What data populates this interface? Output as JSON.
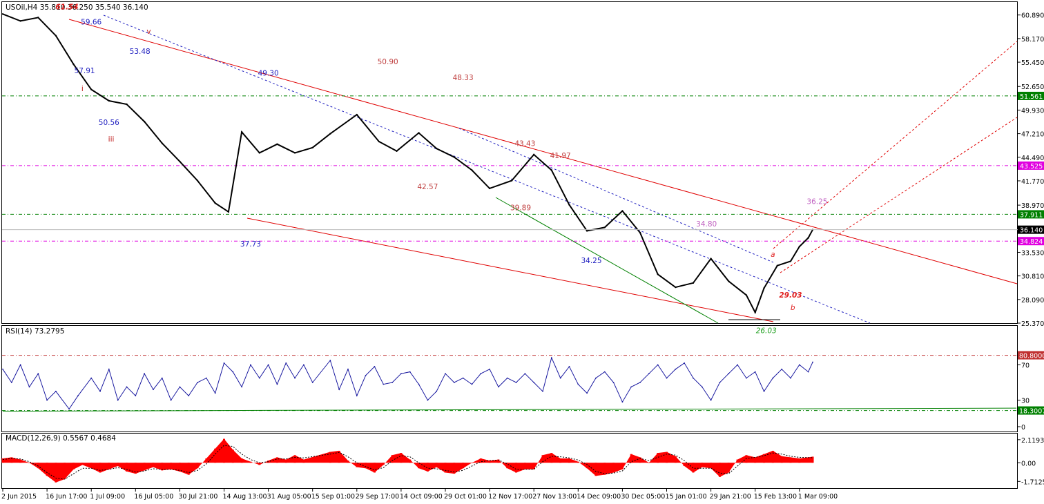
{
  "chart_data": [
    {
      "type": "line",
      "panel": "price",
      "header": "USOil,H4  35.810 36.250 35.540 36.140",
      "symbol": "USOil,H4",
      "ohlc": {
        "open": 35.81,
        "high": 36.25,
        "low": 35.54,
        "close": 36.14
      },
      "current_price_label": "36.140",
      "y_ticks": [
        "60.890",
        "58.170",
        "55.450",
        "52.650",
        "49.930",
        "47.210",
        "44.490",
        "41.770",
        "38.970",
        "36.140",
        "33.530",
        "30.810",
        "28.090",
        "25.370"
      ],
      "ylim": [
        25.37,
        62.3
      ],
      "levels": [
        {
          "label": "51.561",
          "value": 51.561,
          "color": "#008000"
        },
        {
          "label": "43.525",
          "value": 43.525,
          "color": "#e000e0"
        },
        {
          "label": "37.911",
          "value": 37.911,
          "color": "#008000"
        },
        {
          "label": "34.824",
          "value": 34.824,
          "color": "#e000e0"
        }
      ],
      "x_labels": [
        "2 Jun 2015",
        "16 Jun 17:00",
        "1 Jul 09:00",
        "16 Jul 05:00",
        "30 Jul 21:00",
        "14 Aug 13:00",
        "31 Aug 05:00",
        "15 Sep 01:00",
        "29 Sep 17:00",
        "14 Oct 09:00",
        "29 Oct 01:00",
        "12 Nov 17:00",
        "27 Nov 13:00",
        "14 Dec 09:00",
        "30 Dec 05:00",
        "15 Jan 01:00",
        "29 Jan 21:00",
        "15 Feb 13:00",
        "1 Mar 09:00"
      ],
      "x_index": [
        0,
        1,
        2,
        3,
        4,
        5,
        6,
        7,
        8,
        9,
        10,
        11,
        12,
        13,
        14,
        15,
        16,
        17,
        18
      ],
      "series": [
        {
          "values": [
            61.0,
            60.2,
            60.6,
            58.5,
            55.2,
            52.3,
            51.0,
            50.6,
            48.6,
            46.1,
            44.0,
            41.8,
            39.2,
            38.2,
            47.4,
            45.0,
            46.0,
            45.0,
            45.6,
            47.2,
            49.4,
            46.3,
            45.2,
            47.3,
            45.5,
            44.5,
            43.0,
            40.9,
            41.8,
            44.8,
            43.0,
            39.0,
            36.0,
            36.4,
            38.3,
            35.8,
            31.0,
            29.5,
            30.0,
            32.8,
            30.2,
            28.6,
            26.6,
            29.4,
            32.0,
            32.5,
            34.2,
            35.2,
            36.14
          ],
          "x_index": [
            0,
            0.4,
            0.8,
            1.2,
            1.6,
            2.0,
            2.4,
            2.8,
            3.2,
            3.6,
            4.0,
            4.4,
            4.8,
            5.1,
            5.4,
            5.8,
            6.2,
            6.6,
            7.0,
            7.4,
            8.0,
            8.5,
            8.9,
            9.4,
            9.8,
            10.2,
            10.6,
            11.0,
            11.5,
            12.0,
            12.4,
            12.8,
            13.2,
            13.6,
            14.0,
            14.4,
            14.8,
            15.2,
            15.6,
            16.0,
            16.4,
            16.8,
            17.0,
            17.2,
            17.5,
            17.8,
            18.0,
            18.2,
            18.3
          ]
        }
      ],
      "annotations": [
        {
          "text": "61.54",
          "value": 61.54,
          "x_index": 1.45,
          "color": "#e02020"
        },
        {
          "text": "59.66",
          "value": 59.8,
          "x_index": 2.0,
          "color": "#2020c0"
        },
        {
          "text": "v",
          "value": 58.7,
          "x_index": 3.3,
          "color": "#c02020"
        },
        {
          "text": "53.48",
          "value": 56.4,
          "x_index": 3.1,
          "color": "#2020c0"
        },
        {
          "text": "57.91",
          "value": 54.2,
          "x_index": 1.85,
          "color": "#2020c0"
        },
        {
          "text": "i",
          "value": 52.1,
          "x_index": 1.8,
          "color": "#c02020"
        },
        {
          "text": "49.30",
          "value": 53.9,
          "x_index": 6.0,
          "color": "#2020c0"
        },
        {
          "text": "50.90",
          "value": 55.2,
          "x_index": 8.7,
          "color": "#c04040"
        },
        {
          "text": "48.33",
          "value": 53.4,
          "x_index": 10.4,
          "color": "#c04040"
        },
        {
          "text": "50.56",
          "value": 48.2,
          "x_index": 2.4,
          "color": "#2020c0"
        },
        {
          "text": "iii",
          "value": 46.3,
          "x_index": 2.45,
          "color": "#c02020"
        },
        {
          "text": "43.43",
          "value": 45.8,
          "x_index": 11.8,
          "color": "#c04040"
        },
        {
          "text": "41.97",
          "value": 44.4,
          "x_index": 12.6,
          "color": "#c04040"
        },
        {
          "text": "42.57",
          "value": 40.8,
          "x_index": 9.6,
          "color": "#c04040"
        },
        {
          "text": "39.89",
          "value": 38.4,
          "x_index": 11.7,
          "color": "#c04040"
        },
        {
          "text": "37.73",
          "value": 34.2,
          "x_index": 5.6,
          "color": "#2020c0"
        },
        {
          "text": "34.25",
          "value": 32.3,
          "x_index": 13.3,
          "color": "#2020c0"
        },
        {
          "text": "34.80",
          "value": 36.5,
          "x_index": 15.9,
          "color": "#c060c0"
        },
        {
          "text": "36.25",
          "value": 39.1,
          "x_index": 18.4,
          "color": "#c060c0"
        },
        {
          "text": "a",
          "value": 33.0,
          "x_index": 17.4,
          "color": "#e02020"
        },
        {
          "text": "29.03",
          "value": 28.3,
          "x_index": 17.8,
          "color": "#e02020"
        },
        {
          "text": "b",
          "value": 26.9,
          "x_index": 17.85,
          "color": "#e02020"
        },
        {
          "text": "26.03",
          "value": 24.2,
          "x_index": 17.25,
          "color": "#20a020"
        }
      ]
    },
    {
      "type": "line",
      "panel": "rsi",
      "header": "RSI(14) 73.2795",
      "ylim": [
        0,
        100
      ],
      "y_ticks": [
        "70",
        "30",
        "0"
      ],
      "levels": [
        {
          "label": "80.8000",
          "value": 80.8,
          "color": "#c03030"
        },
        {
          "label": "18.3007",
          "value": 18.3,
          "color": "#008000"
        }
      ],
      "series": [
        {
          "values": [
            65,
            50,
            70,
            45,
            60,
            30,
            40,
            20,
            35,
            55,
            40,
            65,
            30,
            45,
            35,
            60,
            42,
            55,
            30,
            45,
            35,
            50,
            55,
            38,
            72,
            62,
            45,
            70,
            55,
            70,
            48,
            72,
            55,
            70,
            50,
            75,
            42,
            65,
            35,
            58,
            68,
            48,
            50,
            60,
            62,
            48,
            30,
            40,
            60,
            50,
            55,
            48,
            60,
            65,
            45,
            55,
            50,
            60,
            50,
            40,
            78,
            55,
            68,
            48,
            38,
            55,
            62,
            50,
            28,
            45,
            50,
            60,
            70,
            55,
            65,
            72,
            55,
            45,
            30,
            50,
            60,
            70,
            55,
            62,
            40,
            55,
            65,
            55,
            70,
            62,
            73
          ],
          "x_index": [
            0,
            0.2,
            0.4,
            0.6,
            0.8,
            1.0,
            1.2,
            1.5,
            1.7,
            2.0,
            2.2,
            2.4,
            2.6,
            2.8,
            3.0,
            3.2,
            3.4,
            3.6,
            3.8,
            4.0,
            4.2,
            4.4,
            4.6,
            4.8,
            5.0,
            5.2,
            5.4,
            5.6,
            5.8,
            6.0,
            6.2,
            6.4,
            6.6,
            6.8,
            7.0,
            7.4,
            7.6,
            7.8,
            8.0,
            8.2,
            8.4,
            8.6,
            8.8,
            9.0,
            9.2,
            9.4,
            9.6,
            9.8,
            10.0,
            10.2,
            10.4,
            10.6,
            10.8,
            11.0,
            11.2,
            11.4,
            11.6,
            11.8,
            12.0,
            12.2,
            12.4,
            12.6,
            12.8,
            13.0,
            13.2,
            13.4,
            13.6,
            13.8,
            14.0,
            14.2,
            14.4,
            14.6,
            14.8,
            15.0,
            15.2,
            15.4,
            15.6,
            15.8,
            16.0,
            16.2,
            16.4,
            16.6,
            16.8,
            17.0,
            17.2,
            17.4,
            17.6,
            17.8,
            18.0,
            18.2,
            18.3
          ]
        }
      ]
    },
    {
      "type": "bar",
      "panel": "macd",
      "header": "MACD(12,26,9) 0.5567 0.4684",
      "ylim": [
        -2.2,
        2.3
      ],
      "y_ticks": [
        {
          "label": "2.1193",
          "value": 2.1193
        },
        {
          "label": "0.00",
          "value": 0
        },
        {
          "label": "-1.7125",
          "value": -1.7125
        }
      ],
      "values": [
        0.4,
        0.5,
        0.3,
        0.0,
        -0.5,
        -1.2,
        -1.8,
        -1.5,
        -0.6,
        -0.2,
        -0.5,
        -0.9,
        -0.6,
        -0.3,
        -0.8,
        -1.0,
        -0.7,
        -0.4,
        -0.7,
        -0.6,
        -0.8,
        -1.1,
        -0.5,
        0.4,
        1.3,
        2.2,
        1.2,
        0.4,
        0.1,
        -0.2,
        0.2,
        0.5,
        0.3,
        0.7,
        0.3,
        1.0,
        1.1,
        0.2,
        -0.4,
        -0.5,
        -0.9,
        -0.2,
        0.7,
        0.9,
        0.3,
        -0.5,
        -0.8,
        -0.4,
        -0.9,
        -1.0,
        -0.5,
        0.0,
        0.4,
        0.2,
        0.3,
        -0.5,
        -0.9,
        -0.6,
        -0.6,
        0.7,
        0.9,
        0.4,
        0.4,
        0.1,
        -0.5,
        -1.2,
        -1.1,
        -0.9,
        -0.6,
        0.8,
        0.5,
        0.0,
        0.9,
        1.0,
        0.6,
        -0.3,
        -0.9,
        -0.4,
        -0.5,
        -1.3,
        -0.9,
        0.3,
        0.7,
        0.5,
        0.8,
        1.1,
        0.6,
        0.5,
        0.4,
        0.56
      ],
      "x_index": [
        0,
        0.2,
        0.4,
        0.6,
        0.8,
        1.0,
        1.2,
        1.4,
        1.6,
        1.8,
        2.0,
        2.2,
        2.4,
        2.6,
        2.8,
        3.0,
        3.2,
        3.4,
        3.6,
        3.8,
        4.0,
        4.2,
        4.4,
        4.6,
        4.8,
        5.0,
        5.2,
        5.4,
        5.6,
        5.8,
        6.0,
        6.2,
        6.4,
        6.6,
        6.8,
        7.4,
        7.6,
        7.8,
        8.0,
        8.2,
        8.4,
        8.6,
        8.8,
        9.0,
        9.2,
        9.4,
        9.6,
        9.8,
        10.0,
        10.2,
        10.4,
        10.6,
        10.8,
        11.0,
        11.2,
        11.4,
        11.6,
        11.8,
        12.0,
        12.2,
        12.4,
        12.6,
        12.8,
        13.0,
        13.2,
        13.4,
        13.6,
        13.8,
        14.0,
        14.2,
        14.4,
        14.6,
        14.8,
        15.0,
        15.2,
        15.4,
        15.6,
        15.8,
        16.0,
        16.2,
        16.4,
        16.6,
        16.8,
        17.0,
        17.2,
        17.4,
        17.6,
        17.8,
        18.0,
        18.3
      ],
      "signal_values": [
        0.3,
        0.4,
        0.35,
        0.1,
        -0.3,
        -0.9,
        -1.4,
        -1.5,
        -1.0,
        -0.5,
        -0.5,
        -0.7,
        -0.6,
        -0.45,
        -0.6,
        -0.85,
        -0.75,
        -0.55,
        -0.6,
        -0.6,
        -0.7,
        -0.9,
        -0.7,
        -0.1,
        0.8,
        1.6,
        1.5,
        0.8,
        0.3,
        0.0,
        0.1,
        0.35,
        0.35,
        0.5,
        0.45,
        0.8,
        0.95,
        0.55,
        0.0,
        -0.35,
        -0.65,
        -0.45,
        0.2,
        0.65,
        0.55,
        0.0,
        -0.5,
        -0.55,
        -0.7,
        -0.85,
        -0.7,
        -0.3,
        0.1,
        0.2,
        0.25,
        -0.1,
        -0.6,
        -0.6,
        -0.6,
        0.1,
        0.6,
        0.55,
        0.45,
        0.25,
        -0.15,
        -0.8,
        -1.0,
        -0.95,
        -0.75,
        0.1,
        0.4,
        0.2,
        0.5,
        0.8,
        0.7,
        0.2,
        -0.5,
        -0.5,
        -0.5,
        -0.95,
        -1.0,
        -0.3,
        0.4,
        0.5,
        0.65,
        0.9,
        0.8,
        0.6,
        0.5,
        0.47
      ]
    }
  ]
}
